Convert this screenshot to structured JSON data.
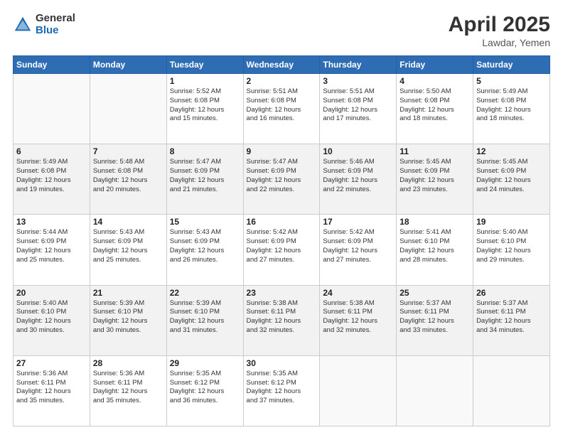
{
  "header": {
    "logo": {
      "general": "General",
      "blue": "Blue"
    },
    "title": "April 2025",
    "subtitle": "Lawdar, Yemen"
  },
  "calendar": {
    "weekdays": [
      "Sunday",
      "Monday",
      "Tuesday",
      "Wednesday",
      "Thursday",
      "Friday",
      "Saturday"
    ],
    "weeks": [
      [
        {
          "day": "",
          "info": ""
        },
        {
          "day": "",
          "info": ""
        },
        {
          "day": "1",
          "info": "Sunrise: 5:52 AM\nSunset: 6:08 PM\nDaylight: 12 hours\nand 15 minutes."
        },
        {
          "day": "2",
          "info": "Sunrise: 5:51 AM\nSunset: 6:08 PM\nDaylight: 12 hours\nand 16 minutes."
        },
        {
          "day": "3",
          "info": "Sunrise: 5:51 AM\nSunset: 6:08 PM\nDaylight: 12 hours\nand 17 minutes."
        },
        {
          "day": "4",
          "info": "Sunrise: 5:50 AM\nSunset: 6:08 PM\nDaylight: 12 hours\nand 18 minutes."
        },
        {
          "day": "5",
          "info": "Sunrise: 5:49 AM\nSunset: 6:08 PM\nDaylight: 12 hours\nand 18 minutes."
        }
      ],
      [
        {
          "day": "6",
          "info": "Sunrise: 5:49 AM\nSunset: 6:08 PM\nDaylight: 12 hours\nand 19 minutes."
        },
        {
          "day": "7",
          "info": "Sunrise: 5:48 AM\nSunset: 6:08 PM\nDaylight: 12 hours\nand 20 minutes."
        },
        {
          "day": "8",
          "info": "Sunrise: 5:47 AM\nSunset: 6:09 PM\nDaylight: 12 hours\nand 21 minutes."
        },
        {
          "day": "9",
          "info": "Sunrise: 5:47 AM\nSunset: 6:09 PM\nDaylight: 12 hours\nand 22 minutes."
        },
        {
          "day": "10",
          "info": "Sunrise: 5:46 AM\nSunset: 6:09 PM\nDaylight: 12 hours\nand 22 minutes."
        },
        {
          "day": "11",
          "info": "Sunrise: 5:45 AM\nSunset: 6:09 PM\nDaylight: 12 hours\nand 23 minutes."
        },
        {
          "day": "12",
          "info": "Sunrise: 5:45 AM\nSunset: 6:09 PM\nDaylight: 12 hours\nand 24 minutes."
        }
      ],
      [
        {
          "day": "13",
          "info": "Sunrise: 5:44 AM\nSunset: 6:09 PM\nDaylight: 12 hours\nand 25 minutes."
        },
        {
          "day": "14",
          "info": "Sunrise: 5:43 AM\nSunset: 6:09 PM\nDaylight: 12 hours\nand 25 minutes."
        },
        {
          "day": "15",
          "info": "Sunrise: 5:43 AM\nSunset: 6:09 PM\nDaylight: 12 hours\nand 26 minutes."
        },
        {
          "day": "16",
          "info": "Sunrise: 5:42 AM\nSunset: 6:09 PM\nDaylight: 12 hours\nand 27 minutes."
        },
        {
          "day": "17",
          "info": "Sunrise: 5:42 AM\nSunset: 6:09 PM\nDaylight: 12 hours\nand 27 minutes."
        },
        {
          "day": "18",
          "info": "Sunrise: 5:41 AM\nSunset: 6:10 PM\nDaylight: 12 hours\nand 28 minutes."
        },
        {
          "day": "19",
          "info": "Sunrise: 5:40 AM\nSunset: 6:10 PM\nDaylight: 12 hours\nand 29 minutes."
        }
      ],
      [
        {
          "day": "20",
          "info": "Sunrise: 5:40 AM\nSunset: 6:10 PM\nDaylight: 12 hours\nand 30 minutes."
        },
        {
          "day": "21",
          "info": "Sunrise: 5:39 AM\nSunset: 6:10 PM\nDaylight: 12 hours\nand 30 minutes."
        },
        {
          "day": "22",
          "info": "Sunrise: 5:39 AM\nSunset: 6:10 PM\nDaylight: 12 hours\nand 31 minutes."
        },
        {
          "day": "23",
          "info": "Sunrise: 5:38 AM\nSunset: 6:11 PM\nDaylight: 12 hours\nand 32 minutes."
        },
        {
          "day": "24",
          "info": "Sunrise: 5:38 AM\nSunset: 6:11 PM\nDaylight: 12 hours\nand 32 minutes."
        },
        {
          "day": "25",
          "info": "Sunrise: 5:37 AM\nSunset: 6:11 PM\nDaylight: 12 hours\nand 33 minutes."
        },
        {
          "day": "26",
          "info": "Sunrise: 5:37 AM\nSunset: 6:11 PM\nDaylight: 12 hours\nand 34 minutes."
        }
      ],
      [
        {
          "day": "27",
          "info": "Sunrise: 5:36 AM\nSunset: 6:11 PM\nDaylight: 12 hours\nand 35 minutes."
        },
        {
          "day": "28",
          "info": "Sunrise: 5:36 AM\nSunset: 6:11 PM\nDaylight: 12 hours\nand 35 minutes."
        },
        {
          "day": "29",
          "info": "Sunrise: 5:35 AM\nSunset: 6:12 PM\nDaylight: 12 hours\nand 36 minutes."
        },
        {
          "day": "30",
          "info": "Sunrise: 5:35 AM\nSunset: 6:12 PM\nDaylight: 12 hours\nand 37 minutes."
        },
        {
          "day": "",
          "info": ""
        },
        {
          "day": "",
          "info": ""
        },
        {
          "day": "",
          "info": ""
        }
      ]
    ]
  }
}
